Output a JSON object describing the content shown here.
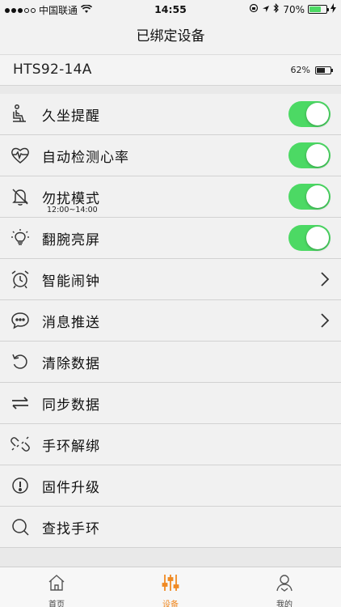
{
  "status_bar": {
    "carrier": "中国联通",
    "time": "14:55",
    "battery_percent": "70%",
    "battery_level": 0.7
  },
  "nav": {
    "title": "已绑定设备"
  },
  "device": {
    "name": "HTS92-14A",
    "battery_text": "62%",
    "battery_level": 0.62
  },
  "settings": {
    "items": [
      {
        "label": "久坐提醒",
        "icon": "sitting-person-icon",
        "control": "toggle",
        "on": true
      },
      {
        "label": "自动检测心率",
        "icon": "heartbeat-icon",
        "control": "toggle",
        "on": true
      },
      {
        "label": "勿扰模式",
        "sub": "12:00~14:00",
        "icon": "bell-off-icon",
        "control": "toggle",
        "on": true
      },
      {
        "label": "翻腕亮屏",
        "icon": "lightbulb-icon",
        "control": "toggle",
        "on": true
      },
      {
        "label": "智能闹钟",
        "icon": "alarm-clock-icon",
        "control": "chevron"
      },
      {
        "label": "消息推送",
        "icon": "message-bubble-icon",
        "control": "chevron"
      },
      {
        "label": "清除数据",
        "icon": "refresh-icon",
        "control": "none"
      },
      {
        "label": "同步数据",
        "icon": "sync-arrows-icon",
        "control": "none"
      },
      {
        "label": "手环解绑",
        "icon": "unlink-icon",
        "control": "none"
      },
      {
        "label": "固件升级",
        "icon": "firmware-icon",
        "control": "none"
      },
      {
        "label": "查找手环",
        "icon": "search-icon",
        "control": "none"
      }
    ]
  },
  "tabbar": {
    "tabs": [
      {
        "label": "首页",
        "icon": "home-icon"
      },
      {
        "label": "设备",
        "icon": "sliders-icon",
        "active": true
      },
      {
        "label": "我的",
        "icon": "profile-icon"
      }
    ],
    "active_color": "#f08a24"
  },
  "colors": {
    "toggle_on": "#4cd964",
    "accent": "#f08a24"
  }
}
